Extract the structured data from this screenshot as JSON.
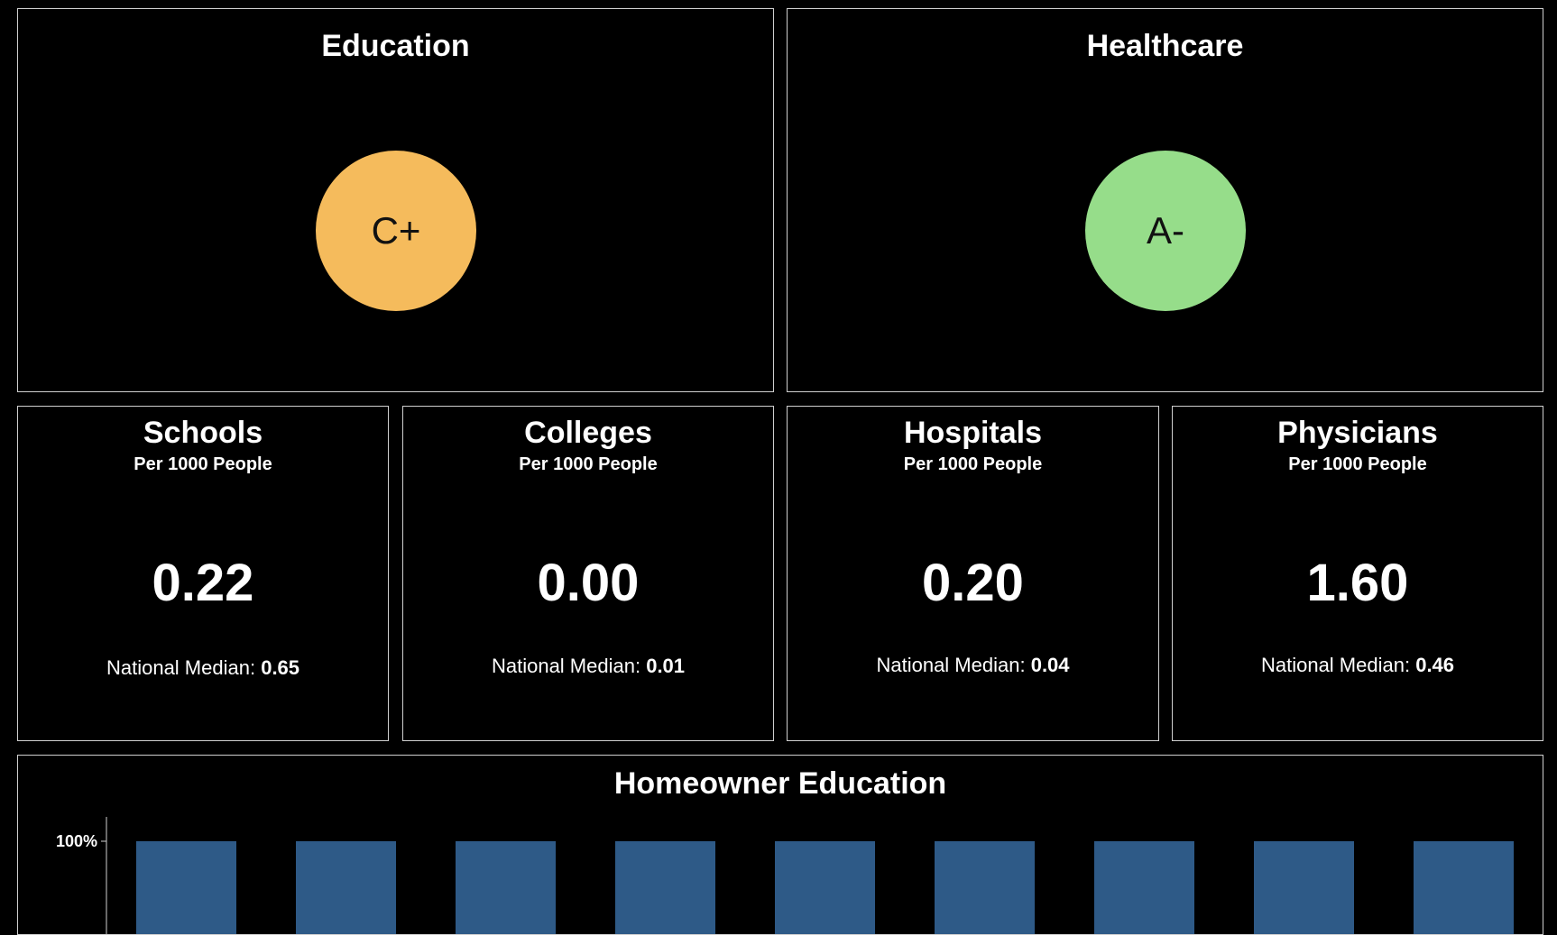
{
  "grades": [
    {
      "title": "Education",
      "grade": "C+",
      "color": "#f5bb5c"
    },
    {
      "title": "Healthcare",
      "grade": "A-",
      "color": "#96dd8a"
    }
  ],
  "metrics": [
    {
      "title": "Schools",
      "subtitle": "Per 1000 People",
      "value": "0.22",
      "median_label": "National Median:",
      "median_value": "0.65"
    },
    {
      "title": "Colleges",
      "subtitle": "Per 1000 People",
      "value": "0.00",
      "median_label": "National Median:",
      "median_value": "0.01"
    },
    {
      "title": "Hospitals",
      "subtitle": "Per 1000 People",
      "value": "0.20",
      "median_label": "National Median:",
      "median_value": "0.04"
    },
    {
      "title": "Physicians",
      "subtitle": "Per 1000 People",
      "value": "1.60",
      "median_label": "National Median:",
      "median_value": "0.46"
    }
  ],
  "homeowner_education": {
    "title": "Homeowner Education"
  },
  "chart_data": {
    "type": "bar",
    "title": "Homeowner Education",
    "y_tick_labels": [
      "100%"
    ],
    "bar_count": 9,
    "bar_color": "#2e5a87",
    "note": "bars extend beyond visible area; only upper portion visible"
  }
}
